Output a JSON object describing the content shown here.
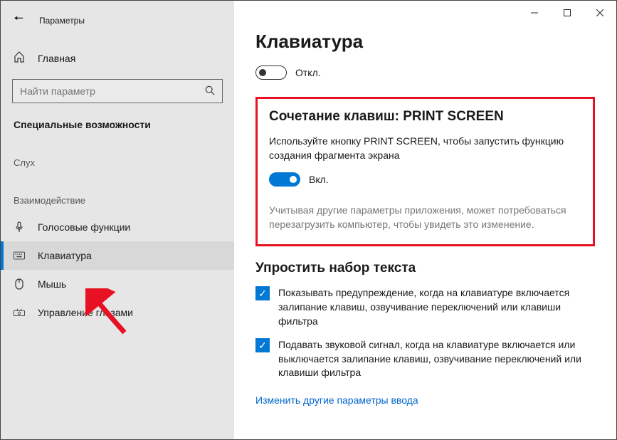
{
  "window": {
    "title": "Параметры"
  },
  "sidebar": {
    "home": "Главная",
    "search_placeholder": "Найти параметр",
    "section": "Специальные возможности",
    "groups": [
      {
        "label": "Слух",
        "items": []
      },
      {
        "label": "Взаимодействие",
        "items": [
          {
            "icon": "mic",
            "label": "Голосовые функции"
          },
          {
            "icon": "keyboard",
            "label": "Клавиатура",
            "selected": true
          },
          {
            "icon": "mouse",
            "label": "Мышь"
          },
          {
            "icon": "eye",
            "label": "Управление глазами"
          }
        ]
      }
    ]
  },
  "main": {
    "title": "Клавиатура",
    "toggle1": {
      "on": false,
      "label": "Откл."
    },
    "printscreen": {
      "heading": "Сочетание клавиш: PRINT SCREEN",
      "desc": "Используйте кнопку PRINT SCREEN, чтобы запустить функцию создания фрагмента экрана",
      "toggle_label": "Вкл.",
      "note": "Учитывая другие параметры приложения, может потребоваться перезагрузить компьютер, чтобы увидеть это изменение."
    },
    "simplify": {
      "heading": "Упростить набор текста",
      "cb1": "Показывать предупреждение, когда на клавиатуре включается залипание клавиш, озвучивание переключений или клавиши фильтра",
      "cb2": "Подавать звуковой сигнал, когда на клавиатуре включается или выключается залипание клавиш, озвучивание переключений или клавиши фильтра",
      "link": "Изменить другие параметры ввода"
    }
  }
}
